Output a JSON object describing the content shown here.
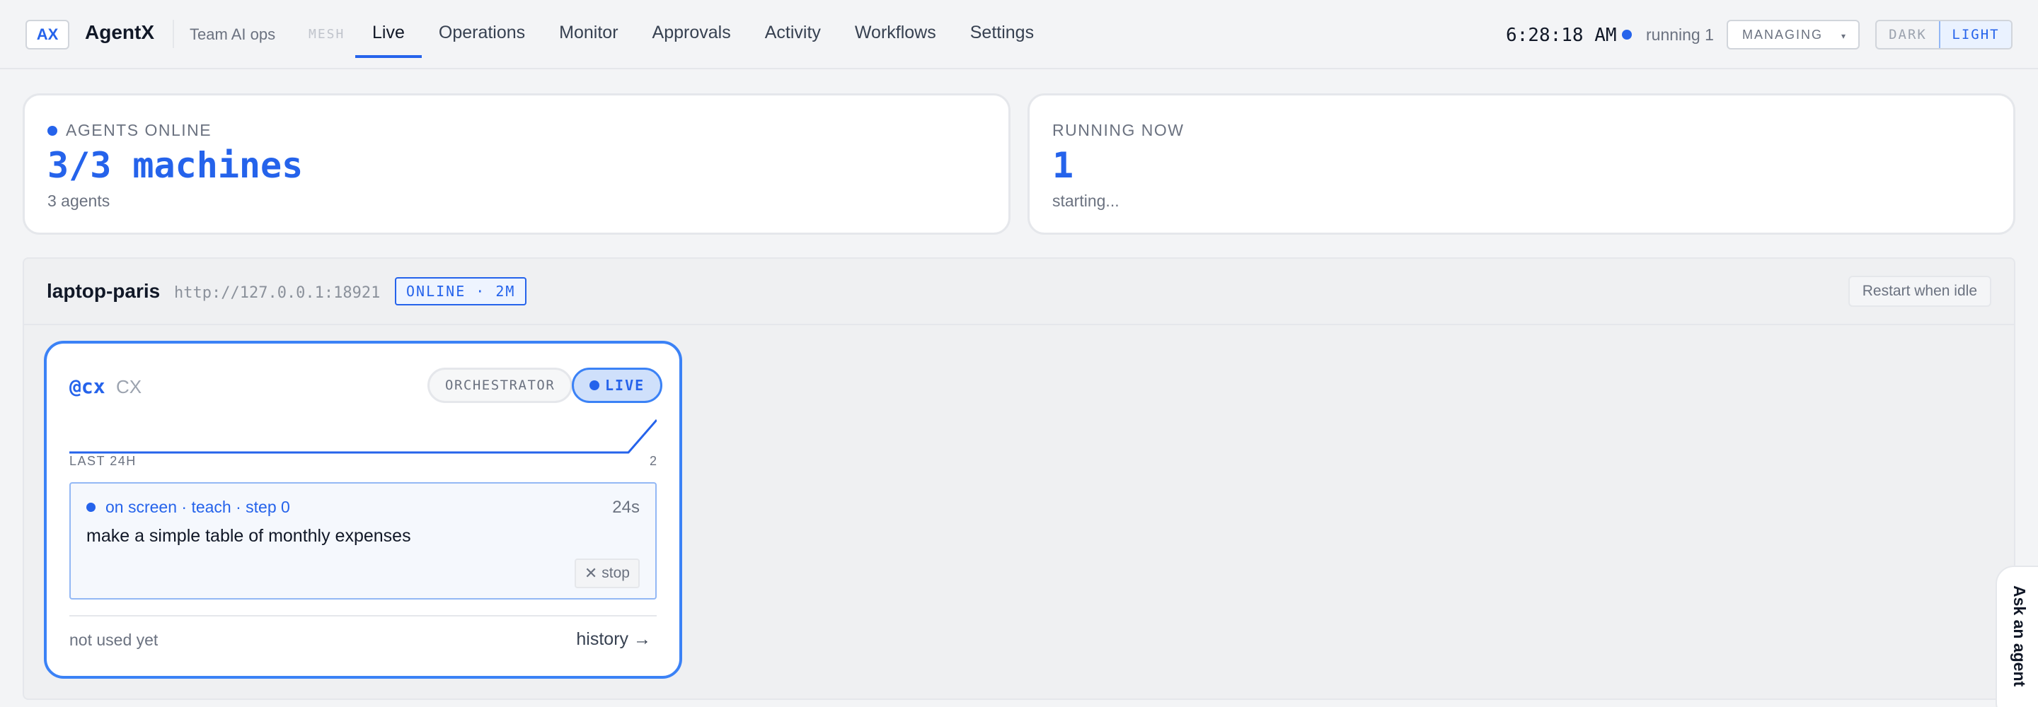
{
  "app": {
    "logo": "AX",
    "name": "AgentX",
    "team": "Team AI ops"
  },
  "nav": {
    "mesh_label": "MESH",
    "items": [
      {
        "label": "Live",
        "active": true
      },
      {
        "label": "Operations"
      },
      {
        "label": "Monitor"
      },
      {
        "label": "Approvals"
      },
      {
        "label": "Activity"
      },
      {
        "label": "Workflows"
      },
      {
        "label": "Settings"
      }
    ]
  },
  "status": {
    "clock": "6:28:18 AM",
    "running_label": "running 1",
    "managing_label": "MANAGING",
    "theme_dark": "DARK",
    "theme_light": "LIGHT",
    "theme_selected": "LIGHT"
  },
  "stats": {
    "agents_online": {
      "label": "AGENTS ONLINE",
      "value": "3/3 machines",
      "sub": "3 agents"
    },
    "running_now": {
      "label": "RUNNING NOW",
      "value": "1",
      "sub": "starting..."
    }
  },
  "machine": {
    "name": "laptop-paris",
    "url": "http://127.0.0.1:18921",
    "badge": "ONLINE · 2M",
    "restart_label": "Restart when idle"
  },
  "agent": {
    "handle": "@cx",
    "code": "CX",
    "role_pill": "ORCHESTRATOR",
    "live_pill": "LIVE",
    "spark_label": "LAST 24H",
    "spark_max": "2",
    "activity_24h": [
      0,
      0,
      0,
      0,
      0,
      0,
      0,
      0,
      0,
      0,
      0,
      0,
      0,
      0,
      0,
      0,
      0,
      0,
      0,
      0,
      0,
      0,
      0,
      2
    ],
    "task": {
      "status": "on screen · teach · step 0",
      "elapsed": "24s",
      "text": "make a simple table of monthly expenses",
      "stop_label": "stop"
    },
    "footer_left": "not used yet",
    "history_label": "history →"
  },
  "ask_tab": {
    "label": "Ask an agent"
  },
  "colors": {
    "accent": "#2563eb",
    "background": "#f3f4f6",
    "card": "#ffffff"
  }
}
